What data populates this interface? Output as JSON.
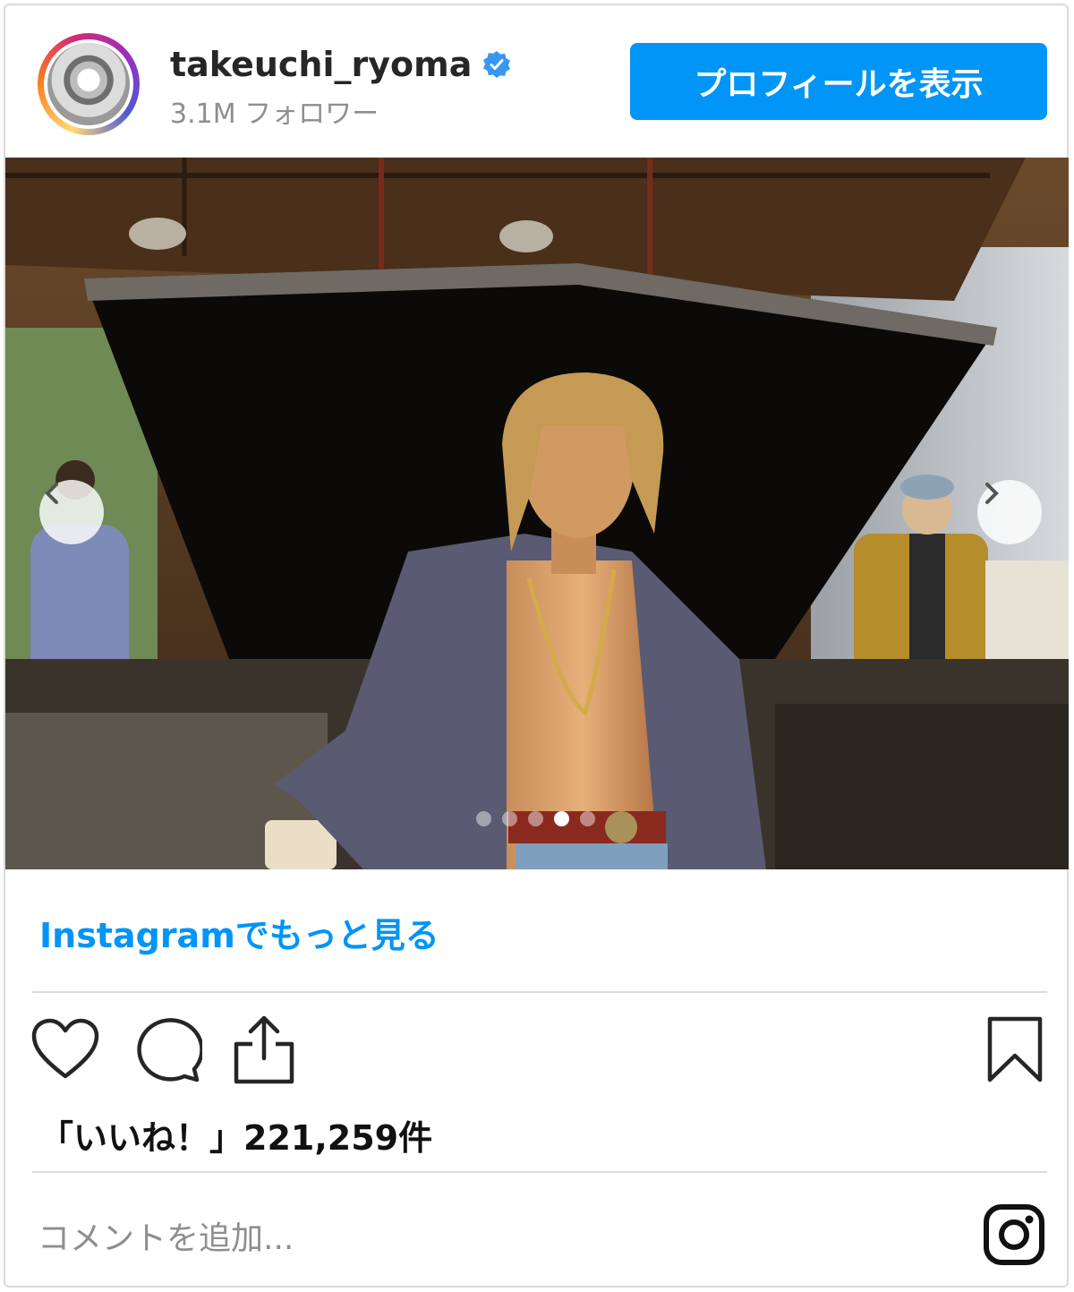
{
  "header": {
    "username": "takeuchi_ryoma",
    "followers": "3.1M フォロワー",
    "profile_button": "プロフィールを表示",
    "verified_icon": "verified-badge-icon"
  },
  "post": {
    "carousel_total": 5,
    "carousel_active": 4,
    "prev_icon": "chevron-left-icon",
    "next_icon": "chevron-right-icon"
  },
  "more_link": "Instagramでもっと見る",
  "actions": {
    "like_icon": "heart-icon",
    "comment_icon": "comment-icon",
    "share_icon": "share-icon",
    "save_icon": "bookmark-icon"
  },
  "likes": "「いいね！」221,259件",
  "comment": {
    "placeholder": "コメントを追加...",
    "instagram_icon": "instagram-logo-icon"
  },
  "colors": {
    "accent": "#0095f6",
    "text": "#262626",
    "muted": "#8e8e8e",
    "border": "#dbdbdb"
  }
}
